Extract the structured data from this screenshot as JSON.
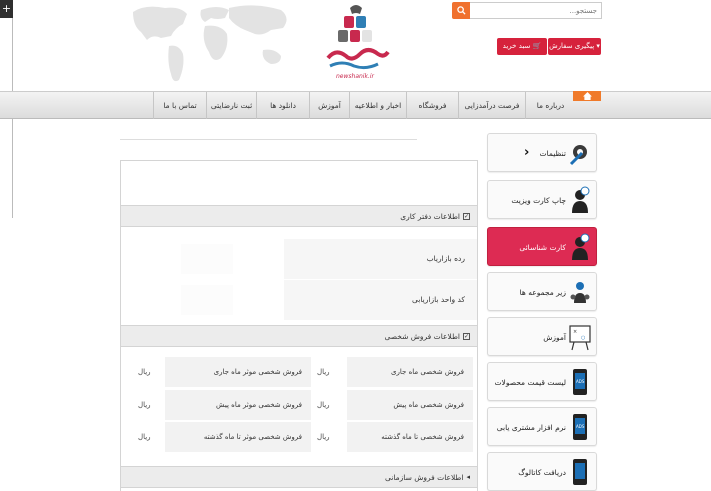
{
  "header": {
    "search_placeholder": "جستجو...",
    "cart_label": "سبد خرید",
    "track_label": "پیگیری سفارش",
    "logo_text": "newshanik.ir"
  },
  "nav": {
    "home_icon": "home-icon",
    "items": [
      "درباره ما",
      "فرصت درآمدزایی",
      "فروشگاه",
      "اخبار و اطلاعیه",
      "آموزش",
      "دانلود ها",
      "ثبت نارضایتی",
      "تماس با ما"
    ]
  },
  "sidebar": {
    "items": [
      {
        "label": "تنظیمات",
        "icon": "gear-wrench-icon"
      },
      {
        "label": "چاپ کارت ویزیت",
        "icon": "business-card-icon"
      },
      {
        "label": "کارت شناسائی",
        "icon": "id-card-icon"
      },
      {
        "label": "زیر مجموعه ها",
        "icon": "network-icon"
      },
      {
        "label": "آموزش",
        "icon": "whiteboard-icon"
      },
      {
        "label": "لیست قیمت محصولات",
        "icon": "price-list-icon"
      },
      {
        "label": "نرم افزار مشتری یابی",
        "icon": "mobile-app-icon"
      },
      {
        "label": "دریافت کاتالوگ",
        "icon": "catalog-icon"
      }
    ]
  },
  "main": {
    "office_section": "اطلاعات دفتر کاری",
    "office_rows": [
      "رده بازاریاب",
      "کد واحد بازاریابی"
    ],
    "sales_section": "اطلاعات فروش شخصی",
    "unit": "ریال",
    "sales_rows": [
      {
        "label": "فروش شخصی ماه جاری",
        "effective": "فروش شخصی موثر ماه جاری"
      },
      {
        "label": "فروش شخصی ماه پیش",
        "effective": "فروش شخصی موثر ماه پیش"
      },
      {
        "label": "فروش شخصی تا ماه گذشته",
        "effective": "فروش شخصی موثر تا ماه گذشته"
      }
    ],
    "org_section": "اطلاعات فروش سازمانی"
  },
  "colors": {
    "accent": "#d6223c",
    "orange": "#f0712e",
    "active": "#dd2b53"
  }
}
